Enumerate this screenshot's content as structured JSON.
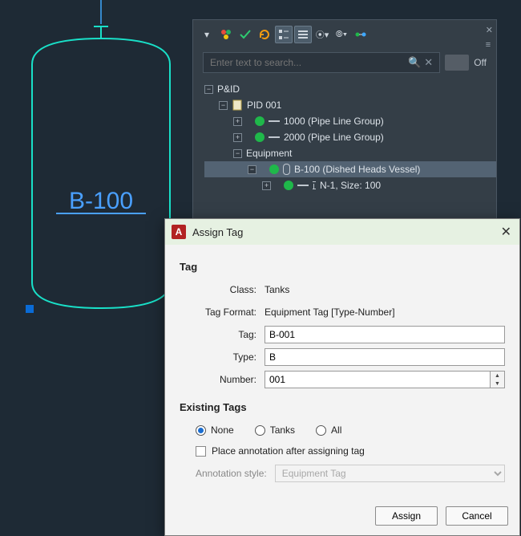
{
  "canvas": {
    "vessel_label": "B-100",
    "colors": {
      "vessel_stroke": "#19e0c8",
      "label": "#4aa0ff"
    }
  },
  "panel": {
    "search_placeholder": "Enter text to search...",
    "toggle_label": "Off",
    "tree": {
      "root": "P&ID",
      "doc": "PID 001",
      "group1": "1000 (Pipe Line Group)",
      "group2": "2000 (Pipe Line Group)",
      "equipment_label": "Equipment",
      "vessel": "B-100 (Dished Heads Vessel)",
      "nozzle": "N-1, Size: 100"
    }
  },
  "dialog": {
    "title": "Assign Tag",
    "sections": {
      "tag": "Tag",
      "existing": "Existing Tags"
    },
    "labels": {
      "class": "Class:",
      "tag_format": "Tag Format:",
      "tag": "Tag:",
      "type": "Type:",
      "number": "Number:",
      "place_anno": "Place annotation after assigning tag",
      "anno_style": "Annotation style:"
    },
    "values": {
      "class": "Tanks",
      "tag_format": "Equipment Tag [Type-Number]",
      "tag": "B-001",
      "type": "B",
      "number": "001",
      "anno_style": "Equipment Tag"
    },
    "radios": {
      "none": "None",
      "tanks": "Tanks",
      "all": "All",
      "selected": "none"
    },
    "buttons": {
      "assign": "Assign",
      "cancel": "Cancel"
    }
  }
}
